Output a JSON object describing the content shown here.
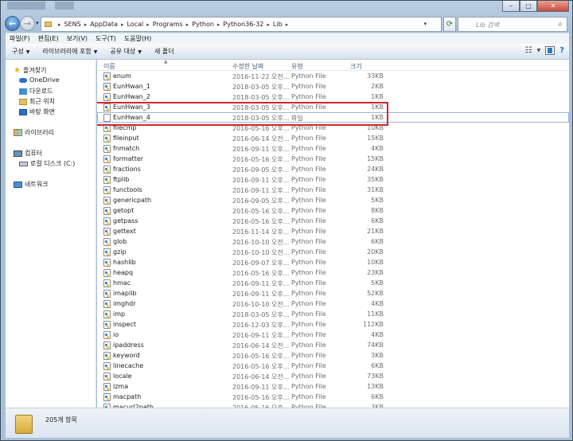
{
  "address": {
    "segments": [
      "SENS",
      "AppData",
      "Local",
      "Programs",
      "Python",
      "Python36-32",
      "Lib"
    ]
  },
  "search": {
    "placeholder": "Lib 검색"
  },
  "menu": [
    "파일(F)",
    "편집(E)",
    "보기(V)",
    "도구(T)",
    "도움말(H)"
  ],
  "commands": [
    "구성",
    "라이브러리에 포함",
    "공유 대상",
    "새 폴더"
  ],
  "sidebar": {
    "favorites": "즐겨찾기",
    "favorite_items": [
      "OneDrive",
      "다운로드",
      "최근 위치",
      "바탕 화면"
    ],
    "libraries": "라이브러리",
    "computer": "컴퓨터",
    "drive": "로컬 디스크 (C:)",
    "network": "네트워크"
  },
  "columns": {
    "name": "이름",
    "date": "수정한 날짜",
    "type": "유형",
    "size": "크기"
  },
  "files": [
    {
      "name": "enum",
      "date": "2016-11-22 오전...",
      "type": "Python File",
      "size": "33KB"
    },
    {
      "name": "EunHwan_1",
      "date": "2018-03-05 오후...",
      "type": "Python File",
      "size": "2KB"
    },
    {
      "name": "EunHwan_2",
      "date": "2018-03-05 오후...",
      "type": "Python File",
      "size": "1KB"
    },
    {
      "name": "EunHwan_3",
      "date": "2018-03-05 오후...",
      "type": "Python File",
      "size": "1KB"
    },
    {
      "name": "EunHwan_4",
      "date": "2018-03-05 오후...",
      "type": "파일",
      "size": "1KB"
    },
    {
      "name": "filecmp",
      "date": "2016-05-16 오후...",
      "type": "Python File",
      "size": "10KB"
    },
    {
      "name": "fileinput",
      "date": "2016-06-14 오전...",
      "type": "Python File",
      "size": "15KB"
    },
    {
      "name": "fnmatch",
      "date": "2016-09-11 오후...",
      "type": "Python File",
      "size": "4KB"
    },
    {
      "name": "formatter",
      "date": "2016-05-16 오후...",
      "type": "Python File",
      "size": "15KB"
    },
    {
      "name": "fractions",
      "date": "2016-09-05 오후...",
      "type": "Python File",
      "size": "24KB"
    },
    {
      "name": "ftplib",
      "date": "2016-09-11 오후...",
      "type": "Python File",
      "size": "35KB"
    },
    {
      "name": "functools",
      "date": "2016-09-11 오후...",
      "type": "Python File",
      "size": "31KB"
    },
    {
      "name": "genericpath",
      "date": "2016-09-05 오후...",
      "type": "Python File",
      "size": "5KB"
    },
    {
      "name": "getopt",
      "date": "2016-05-16 오후...",
      "type": "Python File",
      "size": "8KB"
    },
    {
      "name": "getpass",
      "date": "2016-05-16 오후...",
      "type": "Python File",
      "size": "6KB"
    },
    {
      "name": "gettext",
      "date": "2016-11-14 오후...",
      "type": "Python File",
      "size": "21KB"
    },
    {
      "name": "glob",
      "date": "2016-10-10 오전...",
      "type": "Python File",
      "size": "6KB"
    },
    {
      "name": "gzip",
      "date": "2016-10-10 오전...",
      "type": "Python File",
      "size": "20KB"
    },
    {
      "name": "hashlib",
      "date": "2016-09-07 오후...",
      "type": "Python File",
      "size": "10KB"
    },
    {
      "name": "heapq",
      "date": "2016-05-16 오후...",
      "type": "Python File",
      "size": "23KB"
    },
    {
      "name": "hmac",
      "date": "2016-09-11 오후...",
      "type": "Python File",
      "size": "5KB"
    },
    {
      "name": "imaplib",
      "date": "2016-09-11 오후...",
      "type": "Python File",
      "size": "52KB"
    },
    {
      "name": "imghdr",
      "date": "2016-10-10 오전...",
      "type": "Python File",
      "size": "4KB"
    },
    {
      "name": "imp",
      "date": "2018-03-05 오후...",
      "type": "Python File",
      "size": "11KB"
    },
    {
      "name": "inspect",
      "date": "2016-12-03 오후...",
      "type": "Python File",
      "size": "112KB"
    },
    {
      "name": "io",
      "date": "2016-09-11 오후...",
      "type": "Python File",
      "size": "4KB"
    },
    {
      "name": "ipaddress",
      "date": "2016-06-14 오전...",
      "type": "Python File",
      "size": "74KB"
    },
    {
      "name": "keyword",
      "date": "2016-05-16 오후...",
      "type": "Python File",
      "size": "3KB"
    },
    {
      "name": "linecache",
      "date": "2016-05-16 오후...",
      "type": "Python File",
      "size": "6KB"
    },
    {
      "name": "locale",
      "date": "2016-06-14 오전...",
      "type": "Python File",
      "size": "73KB"
    },
    {
      "name": "lzma",
      "date": "2016-09-11 오후...",
      "type": "Python File",
      "size": "13KB"
    },
    {
      "name": "macpath",
      "date": "2016-05-16 오후...",
      "type": "Python File",
      "size": "6KB"
    },
    {
      "name": "macurl2path",
      "date": "2016-05-16 오후...",
      "type": "Python File",
      "size": "3KB"
    }
  ],
  "status": {
    "count": "205개 항목"
  },
  "colors": {
    "highlight": "#d4262b",
    "accent": "#2e6fc8"
  }
}
